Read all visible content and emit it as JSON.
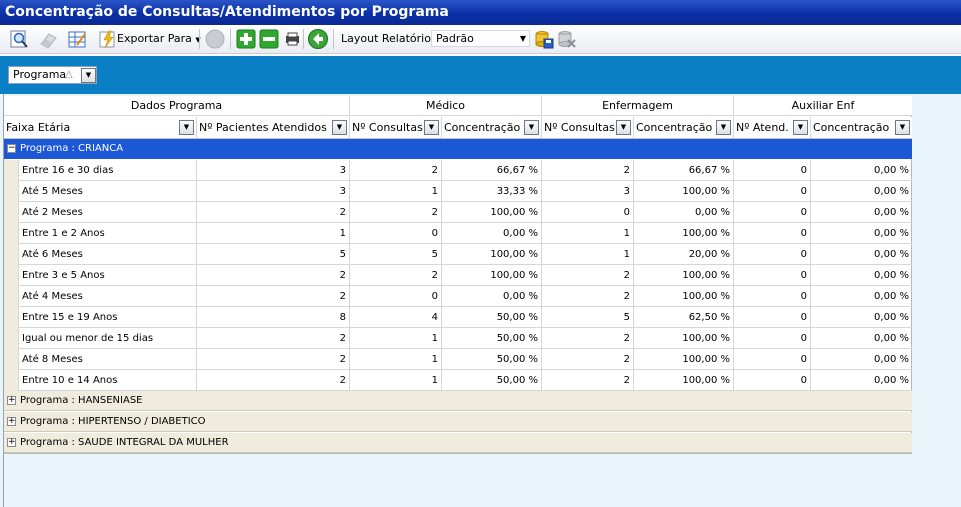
{
  "window": {
    "title": "Concentração de Consultas/Atendimentos por Programa"
  },
  "toolbar": {
    "export_label": "Exportar Para",
    "layout_label": "Layout Relatório",
    "layout_value": "Padrão",
    "icons": [
      "preview-icon",
      "eraser-icon",
      "grid-edit-icon",
      "lightning-icon",
      "circle-icon",
      "expand-icon",
      "collapse-icon",
      "print-icon",
      "back-icon",
      "save-layout-icon",
      "delete-layout-icon"
    ]
  },
  "group_panel": {
    "chip_label": "Programa",
    "sort_glyph": "△"
  },
  "bands": [
    "Dados Programa",
    "Médico",
    "Enfermagem",
    "Auxiliar Enf"
  ],
  "columns": [
    "Faixa Etária",
    "Nº Pacientes Atendidos",
    "Nº Consultas",
    "Concentração",
    "Nº Consultas",
    "Concentração",
    "Nº Atend.",
    "Concentração"
  ],
  "groups": [
    {
      "label": "Programa : CRIANCA",
      "expanded": true,
      "rows": [
        [
          "Entre 16 e 30 dias",
          "3",
          "2",
          "66,67 %",
          "2",
          "66,67 %",
          "0",
          "0,00 %"
        ],
        [
          "Até 5 Meses",
          "3",
          "1",
          "33,33 %",
          "3",
          "100,00 %",
          "0",
          "0,00 %"
        ],
        [
          "Até 2 Meses",
          "2",
          "2",
          "100,00 %",
          "0",
          "0,00 %",
          "0",
          "0,00 %"
        ],
        [
          "Entre 1 e 2 Anos",
          "1",
          "0",
          "0,00 %",
          "1",
          "100,00 %",
          "0",
          "0,00 %"
        ],
        [
          "Até 6 Meses",
          "5",
          "5",
          "100,00 %",
          "1",
          "20,00 %",
          "0",
          "0,00 %"
        ],
        [
          "Entre 3 e 5 Anos",
          "2",
          "2",
          "100,00 %",
          "2",
          "100,00 %",
          "0",
          "0,00 %"
        ],
        [
          "Até 4 Meses",
          "2",
          "0",
          "0,00 %",
          "2",
          "100,00 %",
          "0",
          "0,00 %"
        ],
        [
          "Entre 15 e 19 Anos",
          "8",
          "4",
          "50,00 %",
          "5",
          "62,50 %",
          "0",
          "0,00 %"
        ],
        [
          "Igual ou menor de 15 dias",
          "2",
          "1",
          "50,00 %",
          "2",
          "100,00 %",
          "0",
          "0,00 %"
        ],
        [
          "Até 8 Meses",
          "2",
          "1",
          "50,00 %",
          "2",
          "100,00 %",
          "0",
          "0,00 %"
        ],
        [
          "Entre 10 e 14 Anos",
          "2",
          "1",
          "50,00 %",
          "2",
          "100,00 %",
          "0",
          "0,00 %"
        ]
      ]
    },
    {
      "label": "Programa : HANSENIASE",
      "expanded": false
    },
    {
      "label": "Programa : HIPERTENSO / DIABETICO",
      "expanded": false
    },
    {
      "label": "Programa : SAUDE INTEGRAL DA MULHER",
      "expanded": false
    }
  ],
  "colors": {
    "title_bar": "#0a2fa6",
    "group_panel": "#0a7fc6",
    "selected_group": "#1c57d6",
    "group_row": "#efebdd"
  }
}
